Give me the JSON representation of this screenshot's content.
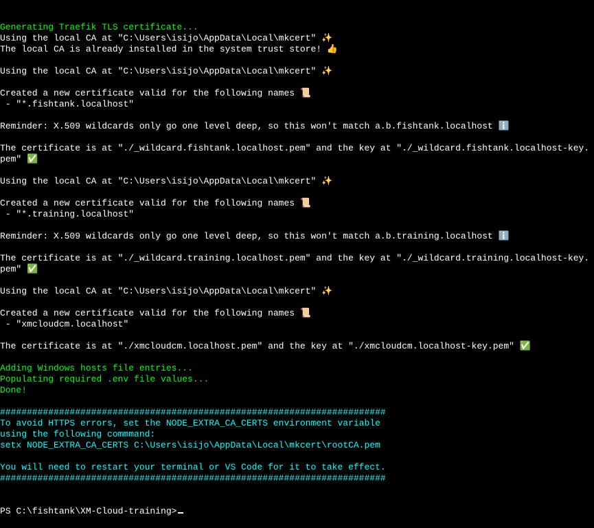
{
  "terminal": {
    "lines": [
      {
        "text": "Generating Traefik TLS certificate...",
        "color": "green"
      },
      {
        "text": "Using the local CA at \"C:\\Users\\isijo\\AppData\\Local\\mkcert\" ✨",
        "color": "white"
      },
      {
        "text": "The local CA is already installed in the system trust store! 👍",
        "color": "white"
      },
      {
        "text": "",
        "color": "white"
      },
      {
        "text": "Using the local CA at \"C:\\Users\\isijo\\AppData\\Local\\mkcert\" ✨",
        "color": "white"
      },
      {
        "text": "",
        "color": "white"
      },
      {
        "text": "Created a new certificate valid for the following names 📜",
        "color": "white"
      },
      {
        "text": " - \"*.fishtank.localhost\"",
        "color": "white"
      },
      {
        "text": "",
        "color": "white"
      },
      {
        "text": "Reminder: X.509 wildcards only go one level deep, so this won't match a.b.fishtank.localhost ℹ️",
        "color": "white"
      },
      {
        "text": "",
        "color": "white"
      },
      {
        "text": "The certificate is at \"./_wildcard.fishtank.localhost.pem\" and the key at \"./_wildcard.fishtank.localhost-key.pem\" ✅",
        "color": "white"
      },
      {
        "text": "",
        "color": "white"
      },
      {
        "text": "Using the local CA at \"C:\\Users\\isijo\\AppData\\Local\\mkcert\" ✨",
        "color": "white"
      },
      {
        "text": "",
        "color": "white"
      },
      {
        "text": "Created a new certificate valid for the following names 📜",
        "color": "white"
      },
      {
        "text": " - \"*.training.localhost\"",
        "color": "white"
      },
      {
        "text": "",
        "color": "white"
      },
      {
        "text": "Reminder: X.509 wildcards only go one level deep, so this won't match a.b.training.localhost ℹ️",
        "color": "white"
      },
      {
        "text": "",
        "color": "white"
      },
      {
        "text": "The certificate is at \"./_wildcard.training.localhost.pem\" and the key at \"./_wildcard.training.localhost-key.pem\" ✅",
        "color": "white"
      },
      {
        "text": "",
        "color": "white"
      },
      {
        "text": "Using the local CA at \"C:\\Users\\isijo\\AppData\\Local\\mkcert\" ✨",
        "color": "white"
      },
      {
        "text": "",
        "color": "white"
      },
      {
        "text": "Created a new certificate valid for the following names 📜",
        "color": "white"
      },
      {
        "text": " - \"xmcloudcm.localhost\"",
        "color": "white"
      },
      {
        "text": "",
        "color": "white"
      },
      {
        "text": "The certificate is at \"./xmcloudcm.localhost.pem\" and the key at \"./xmcloudcm.localhost-key.pem\" ✅",
        "color": "white"
      },
      {
        "text": "",
        "color": "white"
      },
      {
        "text": "Adding Windows hosts file entries...",
        "color": "green"
      },
      {
        "text": "Populating required .env file values...",
        "color": "green"
      },
      {
        "text": "Done!",
        "color": "green"
      },
      {
        "text": "",
        "color": "white"
      },
      {
        "text": "########################################################################",
        "color": "cyan"
      },
      {
        "text": "To avoid HTTPS errors, set the NODE_EXTRA_CA_CERTS environment variable",
        "color": "cyan"
      },
      {
        "text": "using the following commmand:",
        "color": "cyan"
      },
      {
        "text": "setx NODE_EXTRA_CA_CERTS C:\\Users\\isijo\\AppData\\Local\\mkcert\\rootCA.pem",
        "color": "cyan"
      },
      {
        "text": "",
        "color": "cyan"
      },
      {
        "text": "You will need to restart your terminal or VS Code for it to take effect.",
        "color": "cyan"
      },
      {
        "text": "########################################################################",
        "color": "cyan"
      }
    ],
    "prompt": "PS C:\\fishtank\\XM-Cloud-training>"
  }
}
